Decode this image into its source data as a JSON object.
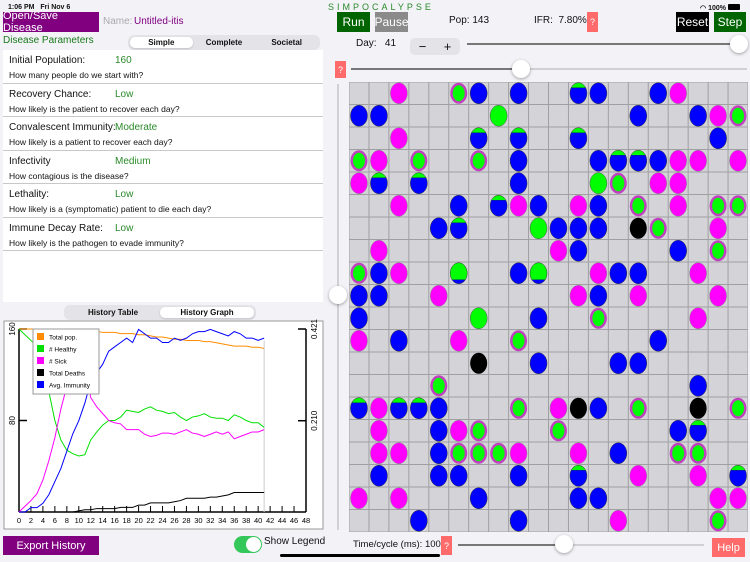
{
  "status": {
    "time": "1:06 PM",
    "date": "Fri Nov 6",
    "battery": "100%"
  },
  "app_title": "SIMPOCALYPSE",
  "disease": {
    "open_save_label": "Open/Save Disease",
    "name_label": "Name:",
    "name_value": "Untitled-itis"
  },
  "params_header": "Disease Parameters",
  "param_tabs": [
    {
      "label": "Simple",
      "selected": true
    },
    {
      "label": "Complete",
      "selected": false
    },
    {
      "label": "Societal",
      "selected": false
    }
  ],
  "params": [
    {
      "label": "Initial Population:",
      "value": "160",
      "desc": "How many people do we start with?"
    },
    {
      "label": "Recovery Chance:",
      "value": "Low",
      "desc": "How likely is the patient to recover each day?"
    },
    {
      "label": "Convalescent Immunity:",
      "value": "Moderate",
      "desc": "How likely is a patient to recover each day?"
    },
    {
      "label": "Infectivity",
      "value": "Medium",
      "desc": "How contagious is the disease?"
    },
    {
      "label": "Lethality:",
      "value": "Low",
      "desc": "How likely is a (symptomatic) patient to die each day?"
    },
    {
      "label": "Immune Decay Rate:",
      "value": "Low",
      "desc": "How likely is the pathogen to evade immunity?"
    }
  ],
  "history_tabs": [
    {
      "label": "History Table",
      "selected": false
    },
    {
      "label": "History Graph",
      "selected": true
    }
  ],
  "controls": {
    "run": "Run",
    "pause": "Pause",
    "pop_label": "Pop:",
    "pop_value": "143",
    "ifr_label": "IFR:",
    "ifr_value": "7.80%",
    "help_q": "?",
    "reset": "Reset",
    "step": "Step",
    "day_label": "Day:",
    "day_value": "41",
    "minus": "−",
    "plus": "+",
    "day_slider": 1.0,
    "second_slider": 0.43,
    "vertical_slider": 0.5
  },
  "bottom": {
    "export": "Export History",
    "show_legend": "Show Legend",
    "show_legend_on": true,
    "time_label": "Time/cycle (ms):",
    "time_value": "100",
    "time_slider": 0.43,
    "help": "Help"
  },
  "colors": {
    "purple": "#800080",
    "green": "#006400",
    "red": "#ff6b6b",
    "magenta": "#ff00ff",
    "blue": "#0000ff",
    "lime": "#00ff00",
    "black": "#000000"
  },
  "grid": {
    "legend": {
      "P": "sick",
      "B": "immune",
      "G": "healthy",
      "R": "healthy-infected",
      "H": "immune-partial",
      "g": "healthy-partial-immune",
      "K": "dead"
    },
    "rows": [
      "..P..RB.B..HB..BP...",
      "BB.....G......B..BPR",
      "..P...H.H..H......B.",
      "RP.R..R.B...BHHBPP.P",
      "PH.H....B...GR.PP...",
      "..P..B.HPB.PB.R.P.RR",
      "....BH...GBBB.KR..P.",
      ".P........PB....B.R.",
      "RBP..g..Bg..PBB..P..",
      "BB..P......PB.P...P.",
      "B.....G..B..R....P..",
      "P.B..P..R......B....",
      "......K..B...BB.....",
      "....R............B..",
      "HPHHB...R.PKB.R..K.R",
      ".P..BPR...R.....BH..",
      ".PP.BRRRP..P.B..RR..",
      ".B..BB..B..H..P..P.H",
      "P.P...B....BB.....PP",
      "...B....B....P....R."
    ]
  },
  "chart_data": {
    "type": "line",
    "xlim": [
      0,
      48
    ],
    "x_ticks": [
      "0",
      "2",
      "4",
      "6",
      "8",
      "10",
      "12",
      "14",
      "16",
      "18",
      "20",
      "22",
      "24",
      "26",
      "28",
      "30",
      "32",
      "34",
      "36",
      "38",
      "40",
      "42",
      "44",
      "46",
      "48"
    ],
    "ylim": [
      0,
      160
    ],
    "y_ticks": [
      "80",
      "160"
    ],
    "y2lim": [
      0,
      0.421
    ],
    "y2_ticks": [
      "0.210",
      "0.421"
    ],
    "legend_position": "top-left",
    "x": [
      0,
      1,
      2,
      3,
      4,
      5,
      6,
      7,
      8,
      9,
      10,
      11,
      12,
      13,
      14,
      15,
      16,
      17,
      18,
      19,
      20,
      21,
      22,
      23,
      24,
      25,
      26,
      27,
      28,
      29,
      30,
      31,
      32,
      33,
      34,
      35,
      36,
      37,
      38,
      39,
      40,
      41
    ],
    "series": [
      {
        "name": "Total pop.",
        "color": "#ff8c00",
        "axis": "left",
        "values": [
          160,
          160,
          160,
          160,
          160,
          160,
          160,
          160,
          160,
          160,
          159,
          159,
          158,
          158,
          157,
          157,
          157,
          156,
          156,
          156,
          155,
          155,
          154,
          153,
          153,
          152,
          151,
          151,
          150,
          150,
          150,
          149,
          149,
          148,
          147,
          146,
          145,
          145,
          145,
          144,
          144,
          143
        ]
      },
      {
        "name": "# Healthy",
        "color": "#00e000",
        "axis": "left",
        "values": [
          160,
          155,
          150,
          145,
          125,
          105,
          80,
          63,
          54,
          51,
          49,
          50,
          63,
          70,
          76,
          80,
          80,
          83,
          89,
          88,
          87,
          90,
          92,
          89,
          88,
          86,
          87,
          83,
          80,
          83,
          84,
          86,
          83,
          82,
          82,
          80,
          85,
          83,
          80,
          78,
          78,
          74
        ]
      },
      {
        "name": "# Sick",
        "color": "#ff00ff",
        "axis": "left",
        "values": [
          0,
          5,
          10,
          16,
          28,
          45,
          65,
          90,
          110,
          130,
          140,
          130,
          100,
          92,
          86,
          80,
          78,
          77,
          72,
          72,
          72,
          68,
          66,
          67,
          69,
          69,
          68,
          70,
          72,
          69,
          68,
          66,
          68,
          70,
          68,
          70,
          64,
          66,
          68,
          70,
          70,
          72
        ]
      },
      {
        "name": "Total Deaths",
        "color": "#000000",
        "axis": "left",
        "values": [
          0,
          0,
          0,
          0,
          0,
          0,
          0,
          0,
          0,
          0,
          1,
          2,
          2,
          3,
          3,
          3,
          3,
          4,
          4,
          4,
          6,
          6,
          8,
          8,
          8,
          8,
          9,
          10,
          12,
          12,
          12,
          12,
          13,
          13,
          14,
          15,
          17,
          17,
          17,
          17,
          17,
          17
        ]
      },
      {
        "name": "Avg. Immunity",
        "color": "#0000ff",
        "axis": "right",
        "values": [
          0,
          0,
          0.01,
          0.01,
          0.02,
          0.04,
          0.07,
          0.1,
          0.14,
          0.18,
          0.21,
          0.25,
          0.3,
          0.32,
          0.34,
          0.37,
          0.38,
          0.39,
          0.4,
          0.39,
          0.42,
          0.41,
          0.4,
          0.4,
          0.39,
          0.39,
          0.4,
          0.395,
          0.4,
          0.41,
          0.415,
          0.415,
          0.42,
          0.415,
          0.41,
          0.405,
          0.415,
          0.41,
          0.4,
          0.4,
          0.395,
          0.4
        ]
      }
    ]
  }
}
